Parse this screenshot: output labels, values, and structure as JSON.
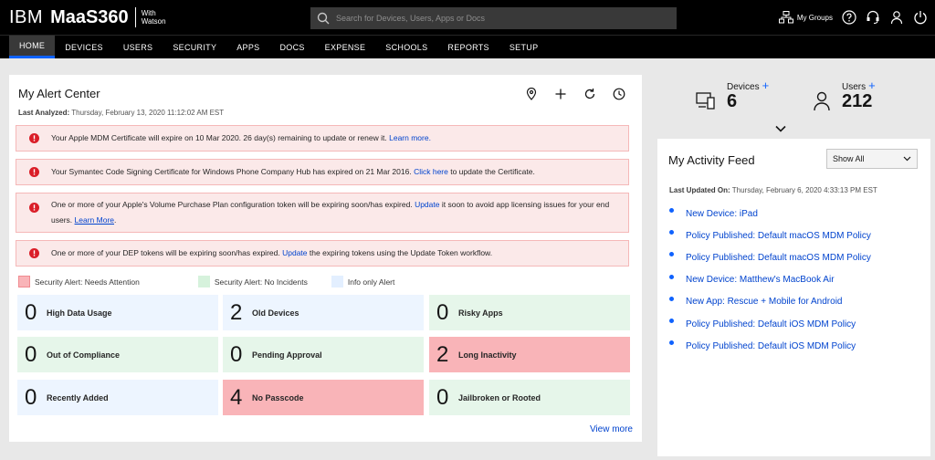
{
  "brand": {
    "ibm": "IBM",
    "product": "MaaS360",
    "with_line1": "With",
    "with_line2": "Watson"
  },
  "search": {
    "placeholder": "Search for Devices, Users, Apps or Docs"
  },
  "top_icons": {
    "my_groups": "My Groups"
  },
  "nav": [
    "HOME",
    "DEVICES",
    "USERS",
    "SECURITY",
    "APPS",
    "DOCS",
    "EXPENSE",
    "SCHOOLS",
    "REPORTS",
    "SETUP"
  ],
  "alert_center": {
    "title": "My Alert Center",
    "last_analyzed_label": "Last Analyzed:",
    "last_analyzed_value": "Thursday, February 13, 2020 11:12:02 AM EST",
    "banners": [
      {
        "text": "Your Apple MDM Certificate will expire on 10 Mar 2020. 26 day(s) remaining to update or renew it.",
        "link": "Learn more."
      },
      {
        "text": "Your Symantec Code Signing Certificate for Windows Phone Company Hub has expired on 21 Mar 2016.",
        "link": "Click here",
        "after": "to update the Certificate."
      },
      {
        "text": "One or more of your Apple's Volume Purchase Plan configuration token will be expiring soon/has expired.",
        "link": "Update",
        "after": "it soon to avoid app licensing issues for your end users.",
        "link2": "Learn More",
        "after2": "."
      },
      {
        "text": "One or more of your DEP tokens will be expiring soon/has expired.",
        "link": "Update",
        "after": "the expiring tokens using the Update Token workflow."
      }
    ],
    "legend": [
      {
        "label": "Security Alert: Needs Attention",
        "color": "#f9b4b8"
      },
      {
        "label": "Security Alert: No Incidents",
        "color": "#d6f2dc"
      },
      {
        "label": "Info only Alert",
        "color": "#e3efff"
      }
    ],
    "tiles": [
      {
        "count": "0",
        "label": "High Data Usage",
        "kind": "blue"
      },
      {
        "count": "2",
        "label": "Old Devices",
        "kind": "blue"
      },
      {
        "count": "0",
        "label": "Risky Apps",
        "kind": "green"
      },
      {
        "count": "0",
        "label": "Out of Compliance",
        "kind": "green"
      },
      {
        "count": "0",
        "label": "Pending Approval",
        "kind": "green"
      },
      {
        "count": "2",
        "label": "Long Inactivity",
        "kind": "red"
      },
      {
        "count": "0",
        "label": "Recently Added",
        "kind": "blue"
      },
      {
        "count": "4",
        "label": "No Passcode",
        "kind": "red"
      },
      {
        "count": "0",
        "label": "Jailbroken or Rooted",
        "kind": "green"
      }
    ],
    "view_more": "View more"
  },
  "stats": {
    "devices_label": "Devices",
    "devices_count": "6",
    "users_label": "Users",
    "users_count": "212",
    "plus": "+"
  },
  "activity_feed": {
    "title": "My Activity Feed",
    "filter_value": "Show All",
    "last_updated_label": "Last Updated On:",
    "last_updated_value": "Thursday, February 6, 2020 4:33:13 PM EST",
    "items": [
      "New Device: iPad",
      "Policy Published: Default macOS MDM Policy",
      "Policy Published: Default macOS MDM Policy",
      "New Device: Matthew's MacBook Air",
      "New App: Rescue + Mobile for Android",
      "Policy Published: Default iOS MDM Policy",
      "Policy Published: Default iOS MDM Policy"
    ]
  },
  "colors": {
    "accent": "#0f62fe",
    "alert_red": "#da1e28",
    "link": "#0043ce"
  }
}
